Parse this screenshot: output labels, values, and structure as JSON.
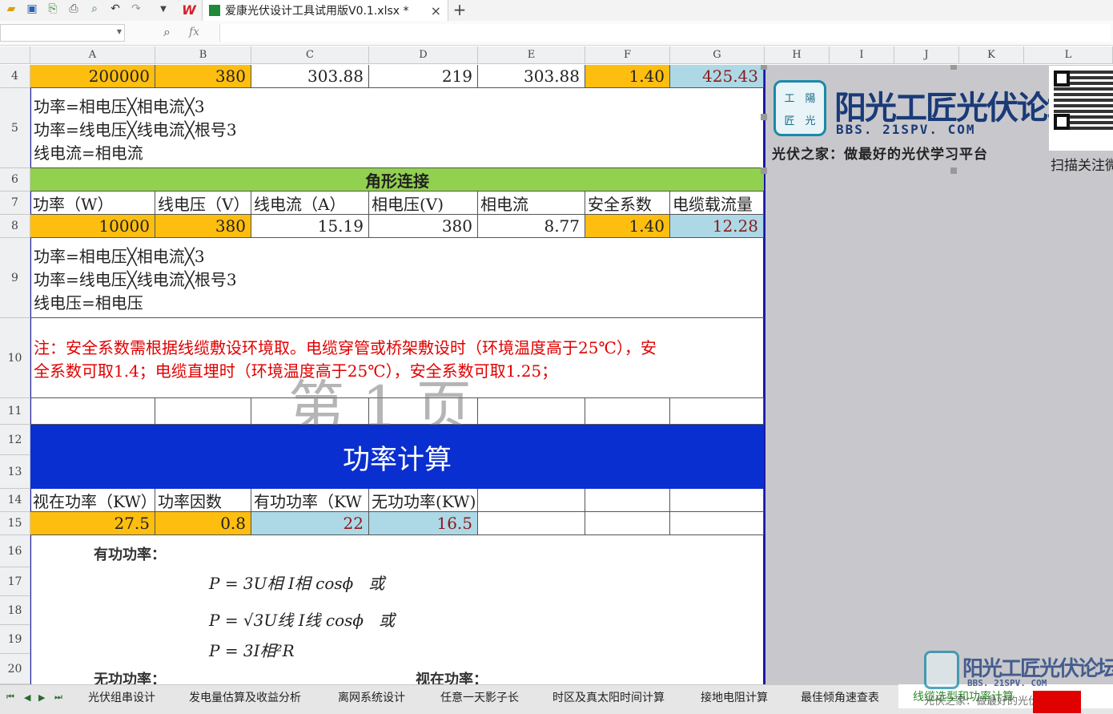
{
  "window": {
    "wps_label": "W",
    "doc_tab": "爱康光伏设计工具试用版V0.1.xlsx *",
    "close_glyph": "×",
    "new_tab_glyph": "+"
  },
  "formula_bar": {
    "name_box": "",
    "zoom_icon": "⌕",
    "fx_label": "fx",
    "value": ""
  },
  "columns": [
    "A",
    "B",
    "C",
    "D",
    "E",
    "F",
    "G",
    "H",
    "I",
    "J",
    "K",
    "L"
  ],
  "rows": [
    "4",
    "5",
    "6",
    "7",
    "8",
    "9",
    "10",
    "11",
    "12",
    "13",
    "14",
    "15",
    "16",
    "17",
    "18",
    "19",
    "20"
  ],
  "row4": [
    "200000",
    "380",
    "303.88",
    "219",
    "303.88",
    "1.40",
    "425.43"
  ],
  "row5": [
    "功率=相电压╳相电流╳3",
    "功率=线电压╳线电流╳根号3",
    "线电流=相电流"
  ],
  "section_delta": "角形连接",
  "row7": [
    "功率（W）",
    "线电压（V）",
    "线电流（A）",
    "相电压(V)",
    "相电流",
    "安全系数",
    "电缆载流量"
  ],
  "row8": [
    "10000",
    "380",
    "15.19",
    "380",
    "8.77",
    "1.40",
    "12.28"
  ],
  "row9": [
    "功率=相电压╳相电流╳3",
    "功率=线电压╳线电流╳根号3",
    "线电压=相电压"
  ],
  "note": [
    "注：安全系数需根据线缆敷设环境取。电缆穿管或桥架敷设时（环境温度高于25℃），安",
    "全系数可取1.4；电缆直埋时（环境温度高于25℃），安全系数可取1.25；"
  ],
  "watermark": "第 1 页",
  "power_title": "功率计算",
  "row14": [
    "视在功率（KW）",
    "功率因数",
    "有功功率（KW",
    "无功功率(KW)"
  ],
  "row15": [
    "27.5",
    "0.8",
    "22",
    "16.5"
  ],
  "formula_image": {
    "active_title": "有功功率：",
    "eq1": "P = 3U相 I相 cosϕ   或",
    "eq2": "P = √3U线 I线 cosϕ   或",
    "eq3": "P = 3I相²R",
    "reactive_title": "无功功率：",
    "apparent_title": "视在功率："
  },
  "logo": {
    "name": "阳光工匠光伏论坛",
    "url": "BBS. 21SPV. COM",
    "slogan": "光伏之家：做最好的光伏学习平台",
    "seal": [
      "工",
      "陽",
      "匠",
      "光"
    ],
    "qr_caption": "扫描关注微"
  },
  "sheet_tabs": [
    "光伏组串设计",
    "发电量估算及收益分析",
    "离网系统设计",
    "任意一天影子长",
    "时区及真太阳时间计算",
    "接地电阻计算",
    "最佳倾角速查表",
    "线缆选型和功率计算"
  ],
  "nav_glyphs": [
    "⏮",
    "◀",
    "▶",
    "⏭"
  ],
  "colors": {
    "orange": "#fdbe10",
    "lightblue": "#add8e6",
    "green": "#92d050",
    "blue": "#0a2fd0",
    "red": "#e00000"
  }
}
